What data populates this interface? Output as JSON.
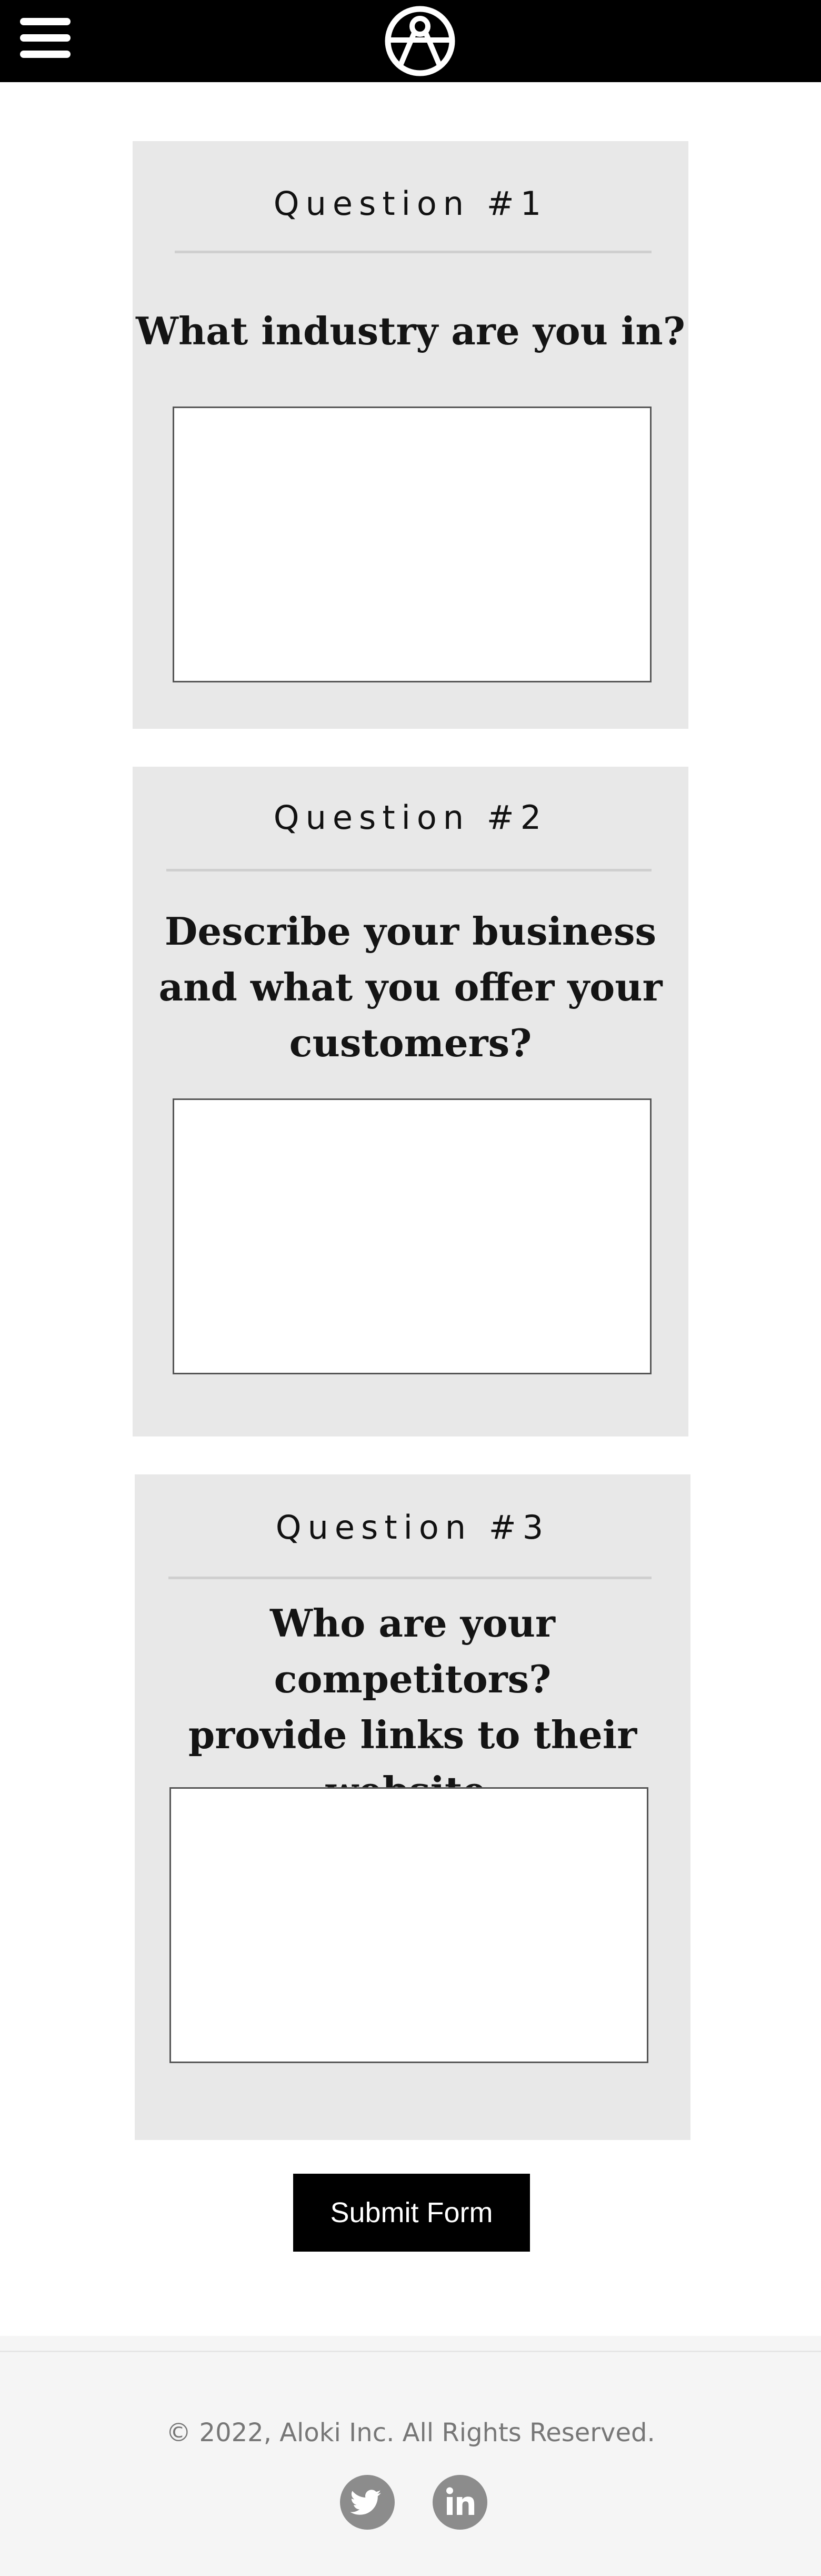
{
  "header": {
    "menu_icon": "hamburger-menu-icon",
    "logo_icon": "aloki-logo-icon"
  },
  "questions": [
    {
      "label": "Question #1",
      "text_lines": [
        "What industry are you in?"
      ],
      "answer": ""
    },
    {
      "label": "Question #2",
      "text_lines": [
        "Describe your business",
        "and what you offer your",
        "customers?"
      ],
      "answer": ""
    },
    {
      "label": "Question #3",
      "text_lines": [
        "Who are your competitors?",
        "provide links to their",
        "website."
      ],
      "answer": ""
    }
  ],
  "submit": {
    "label": "Submit Form"
  },
  "footer": {
    "copyright": "© 2022, Aloki Inc. All Rights Reserved.",
    "social_icons": [
      "twitter-icon",
      "linkedin-icon"
    ]
  },
  "colors": {
    "header_bg": "#000000",
    "card_bg": "#e8e8e8",
    "footer_bg": "#f5f5f5",
    "social_icon_bg": "#8c8c8c"
  }
}
